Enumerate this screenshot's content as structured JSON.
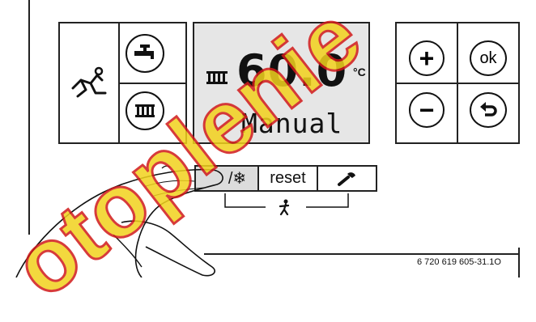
{
  "display": {
    "temperature": "60.0",
    "unit": "°C",
    "mode": "Manual"
  },
  "left_panel": {
    "chimney_sweep_icon": "chimney-sweep-icon",
    "hot_water_icon": "tap-icon",
    "heating_icon": "radiator-icon"
  },
  "right_panel": {
    "plus_label": "+",
    "ok_label": "ok",
    "minus_label": "−",
    "back_icon": "back-arrow-icon"
  },
  "bottom_buttons": {
    "summer_winter_label": "/❄",
    "reset_label": "reset",
    "service_icon": "wrench-icon",
    "combined_icon": "chimney-sweep-small-icon"
  },
  "figure_id": "6 720 619 605-31.1O",
  "watermark": "otoplenie",
  "colors": {
    "lcd_background": "#e6e6e6",
    "watermark_fill": "#f2d21d",
    "watermark_outline": "#d11a1a",
    "line": "#222222"
  }
}
